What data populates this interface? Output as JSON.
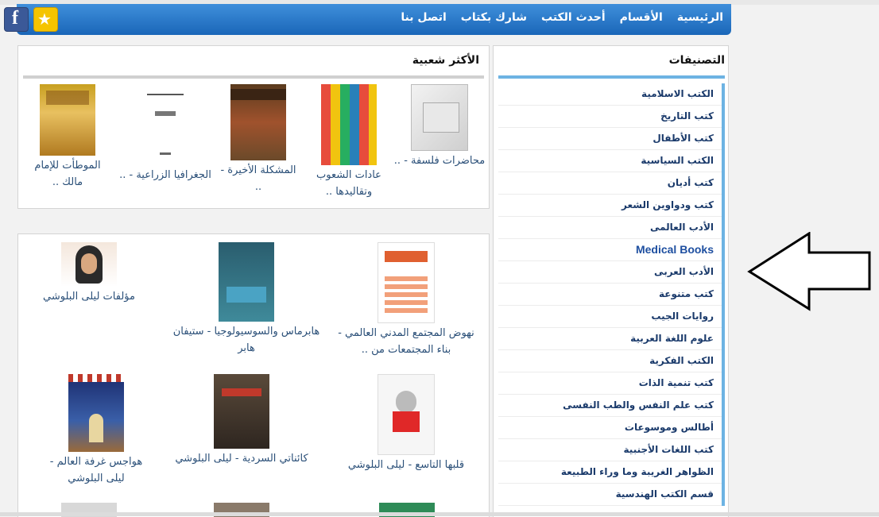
{
  "nav": {
    "links": [
      "الرئيسية",
      "الأقسام",
      "أحدث الكتب",
      "شارك بكتاب",
      "اتصل بنا"
    ]
  },
  "social": {
    "facebook_icon": "f",
    "favorite_icon": "★"
  },
  "popular": {
    "title": "الأكثر شعبية",
    "books": [
      "محاضرات فلسفة - ..",
      "عادات الشعوب وتقاليدها ..",
      "المشكلة الأخيرة - ..",
      "الجغرافيا الزراعية - ..",
      "الموطأت للإمام مالك .."
    ]
  },
  "main": {
    "books": [
      "نهوض المجتمع المدني العالمي - بناء المجتمعات من ..",
      "هابرماس والسوسيولوجيا - ستيفان هابر",
      "مؤلفات ليلى البلوشي",
      "قلبها التاسع - ليلى البلوشي",
      "كائناتي السردية - ليلى البلوشي",
      "هواجس غرفة العالم - ليلى البلوشي"
    ]
  },
  "sidebar": {
    "title": "التصنيفات",
    "items": [
      "الكتب الاسلامية",
      "كتب التاريخ",
      "كتب الأطفال",
      "الكتب السياسية",
      "كتب أديان",
      "كتب ودواوين الشعر",
      "الأدب العالمى",
      "Medical Books",
      "الأدب العربى",
      "كتب متنوعة",
      "روايات الجيب",
      "علوم اللغة العربية",
      "الكتب الفكرية",
      "كتب تنمية الذات",
      "كتب علم النفس والطب النفسى",
      "أطالس وموسوعات",
      "كتب اللغات الأجنبية",
      "الظواهر الغريبة وما وراء الطبيعة",
      "قسم الكتب الهندسية"
    ]
  },
  "colors": {
    "nav": "#1a66b8",
    "link": "#2a4f78",
    "accent": "#6db3e3"
  }
}
